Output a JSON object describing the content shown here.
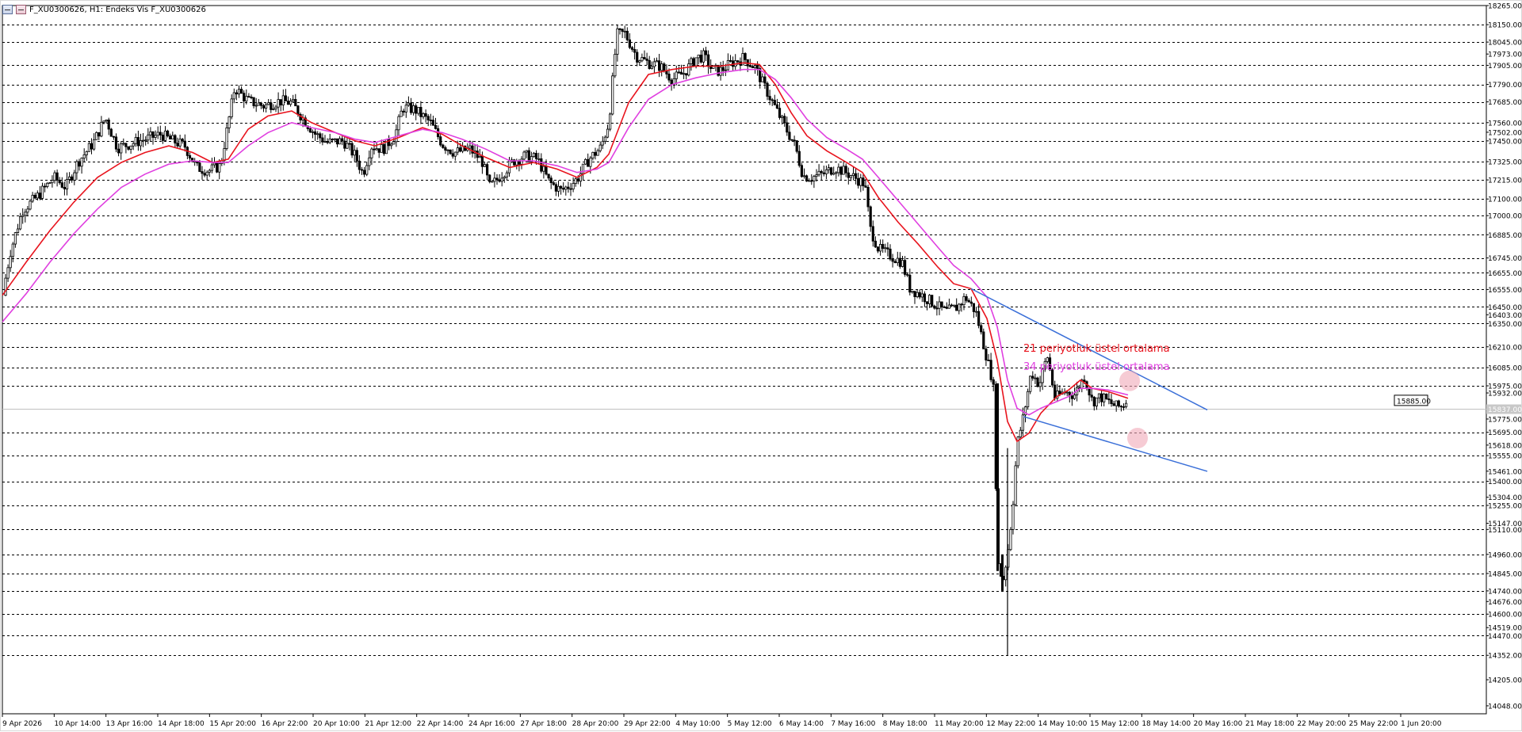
{
  "header": {
    "title": "F_XU0300626, H1:  Endeks Vis F_XU0300626"
  },
  "colors": {
    "ema21": "#e8141e",
    "ema34": "#e040e0",
    "trendlines": "#3a6fd8",
    "grid": "#000000",
    "candles": "#000000",
    "highlight": "#f0a8b8"
  },
  "annotations": {
    "ema21_label": "21 periyotluk üstel ortalama",
    "ema34_label": "34 periyotluk üstel ortalama"
  },
  "chart_data": {
    "type": "candlestick",
    "title": "F_XU0300626, H1:  Endeks Vis F_XU0300626",
    "ylim": [
      14000,
      18265
    ],
    "y_axis_labels": [
      "18265.00",
      "18150.00",
      "18045.00",
      "17973.00",
      "17905.00",
      "17790.00",
      "17685.00",
      "17560.00",
      "17502.00",
      "17450.00",
      "17325.00",
      "17215.00",
      "17100.00",
      "17000.00",
      "16885.00",
      "16745.00",
      "16655.00",
      "16555.00",
      "16450.00",
      "16403.00",
      "16350.00",
      "16210.00",
      "16085.00",
      "15975.00",
      "15932.00",
      "15775.00",
      "15695.00",
      "15618.00",
      "15555.00",
      "15461.00",
      "15400.00",
      "15304.00",
      "15255.00",
      "15147.00",
      "15110.00",
      "14960.00",
      "14845.00",
      "14740.00",
      "14676.00",
      "14600.00",
      "14519.00",
      "14470.00",
      "14352.00",
      "14205.00",
      "14048.00"
    ],
    "dashed_levels": [
      18150,
      18045,
      17905,
      17790,
      17685,
      17560,
      17450,
      17325,
      17215,
      17100,
      17000,
      16885,
      16745,
      16655,
      16555,
      16450,
      16350,
      16210,
      16085,
      15975,
      15695,
      15555,
      15400,
      15255,
      15110,
      14960,
      14845,
      14740,
      14600,
      14470,
      14352
    ],
    "current_price": "15885.00",
    "bid_level_label": "15837.00",
    "bid_level": 15837,
    "x_tick_labels": [
      "9 Apr 2026",
      "10 Apr 14:00",
      "13 Apr 16:00",
      "14 Apr 18:00",
      "15 Apr 20:00",
      "16 Apr 22:00",
      "20 Apr 10:00",
      "21 Apr 12:00",
      "22 Apr 14:00",
      "24 Apr 16:00",
      "27 Apr 18:00",
      "28 Apr 20:00",
      "29 Apr 22:00",
      "4 May 10:00",
      "5 May 12:00",
      "6 May 14:00",
      "7 May 16:00",
      "8 May 18:00",
      "11 May 20:00",
      "12 May 22:00",
      "14 May 10:00",
      "15 May 12:00",
      "18 May 14:00",
      "20 May 16:00",
      "21 May 18:00",
      "22 May 20:00",
      "25 May 22:00",
      "1 Jun 20:00"
    ],
    "price_path": [
      [
        0,
        16520
      ],
      [
        10,
        16780
      ],
      [
        25,
        17030
      ],
      [
        45,
        17120
      ],
      [
        65,
        17230
      ],
      [
        80,
        17170
      ],
      [
        95,
        17320
      ],
      [
        115,
        17440
      ],
      [
        130,
        17590
      ],
      [
        145,
        17410
      ],
      [
        160,
        17430
      ],
      [
        180,
        17460
      ],
      [
        200,
        17490
      ],
      [
        215,
        17450
      ],
      [
        230,
        17420
      ],
      [
        245,
        17290
      ],
      [
        260,
        17270
      ],
      [
        275,
        17300
      ],
      [
        285,
        17560
      ],
      [
        293,
        17770
      ],
      [
        310,
        17690
      ],
      [
        330,
        17660
      ],
      [
        350,
        17690
      ],
      [
        365,
        17680
      ],
      [
        380,
        17580
      ],
      [
        395,
        17490
      ],
      [
        410,
        17440
      ],
      [
        430,
        17450
      ],
      [
        445,
        17360
      ],
      [
        455,
        17250
      ],
      [
        465,
        17420
      ],
      [
        480,
        17400
      ],
      [
        495,
        17480
      ],
      [
        505,
        17650
      ],
      [
        520,
        17640
      ],
      [
        540,
        17560
      ],
      [
        555,
        17430
      ],
      [
        570,
        17380
      ],
      [
        590,
        17400
      ],
      [
        605,
        17330
      ],
      [
        615,
        17170
      ],
      [
        630,
        17250
      ],
      [
        645,
        17330
      ],
      [
        660,
        17360
      ],
      [
        675,
        17340
      ],
      [
        690,
        17200
      ],
      [
        705,
        17150
      ],
      [
        715,
        17180
      ],
      [
        725,
        17220
      ],
      [
        740,
        17340
      ],
      [
        755,
        17410
      ],
      [
        765,
        17560
      ],
      [
        775,
        18090
      ],
      [
        785,
        18100
      ],
      [
        800,
        17960
      ],
      [
        815,
        17920
      ],
      [
        830,
        17900
      ],
      [
        845,
        17820
      ],
      [
        860,
        17860
      ],
      [
        875,
        17950
      ],
      [
        885,
        17960
      ],
      [
        895,
        17880
      ],
      [
        905,
        17870
      ],
      [
        920,
        17920
      ],
      [
        935,
        17950
      ],
      [
        950,
        17890
      ],
      [
        960,
        17790
      ],
      [
        975,
        17650
      ],
      [
        990,
        17510
      ],
      [
        1000,
        17420
      ],
      [
        1010,
        17240
      ],
      [
        1020,
        17230
      ],
      [
        1035,
        17250
      ],
      [
        1050,
        17290
      ],
      [
        1060,
        17270
      ],
      [
        1075,
        17230
      ],
      [
        1088,
        17190
      ],
      [
        1095,
        16920
      ],
      [
        1105,
        16800
      ],
      [
        1120,
        16760
      ],
      [
        1135,
        16720
      ],
      [
        1145,
        16560
      ],
      [
        1160,
        16520
      ],
      [
        1175,
        16470
      ],
      [
        1190,
        16420
      ],
      [
        1205,
        16450
      ],
      [
        1215,
        16510
      ],
      [
        1228,
        16420
      ],
      [
        1240,
        16180
      ],
      [
        1250,
        15990
      ],
      [
        1256,
        14900
      ],
      [
        1262,
        14800
      ],
      [
        1268,
        14960
      ],
      [
        1274,
        15220
      ],
      [
        1280,
        15620
      ],
      [
        1288,
        15790
      ],
      [
        1298,
        16060
      ],
      [
        1308,
        15980
      ],
      [
        1318,
        16160
      ],
      [
        1328,
        15900
      ],
      [
        1340,
        15940
      ],
      [
        1352,
        15920
      ],
      [
        1365,
        16030
      ],
      [
        1375,
        15880
      ],
      [
        1385,
        15910
      ],
      [
        1395,
        15880
      ],
      [
        1405,
        15850
      ],
      [
        1412,
        15850
      ],
      [
        1418,
        15885
      ]
    ],
    "series": [
      {
        "name": "21 periyotluk üstel ortalama",
        "points": [
          [
            0,
            16520
          ],
          [
            30,
            16720
          ],
          [
            60,
            16910
          ],
          [
            90,
            17080
          ],
          [
            120,
            17230
          ],
          [
            150,
            17320
          ],
          [
            180,
            17380
          ],
          [
            210,
            17420
          ],
          [
            240,
            17380
          ],
          [
            265,
            17320
          ],
          [
            285,
            17340
          ],
          [
            310,
            17520
          ],
          [
            335,
            17600
          ],
          [
            365,
            17630
          ],
          [
            390,
            17560
          ],
          [
            420,
            17500
          ],
          [
            445,
            17450
          ],
          [
            470,
            17420
          ],
          [
            500,
            17470
          ],
          [
            530,
            17530
          ],
          [
            555,
            17490
          ],
          [
            580,
            17420
          ],
          [
            610,
            17350
          ],
          [
            640,
            17290
          ],
          [
            670,
            17320
          ],
          [
            700,
            17280
          ],
          [
            725,
            17230
          ],
          [
            750,
            17290
          ],
          [
            765,
            17370
          ],
          [
            790,
            17680
          ],
          [
            815,
            17850
          ],
          [
            845,
            17880
          ],
          [
            875,
            17900
          ],
          [
            905,
            17900
          ],
          [
            935,
            17920
          ],
          [
            955,
            17910
          ],
          [
            975,
            17790
          ],
          [
            995,
            17620
          ],
          [
            1015,
            17480
          ],
          [
            1040,
            17390
          ],
          [
            1065,
            17320
          ],
          [
            1085,
            17260
          ],
          [
            1105,
            17110
          ],
          [
            1130,
            16960
          ],
          [
            1155,
            16830
          ],
          [
            1180,
            16690
          ],
          [
            1200,
            16590
          ],
          [
            1222,
            16560
          ],
          [
            1242,
            16380
          ],
          [
            1255,
            16130
          ],
          [
            1268,
            15760
          ],
          [
            1280,
            15640
          ],
          [
            1295,
            15690
          ],
          [
            1310,
            15810
          ],
          [
            1330,
            15910
          ],
          [
            1345,
            15950
          ],
          [
            1360,
            16010
          ],
          [
            1375,
            15960
          ],
          [
            1395,
            15940
          ],
          [
            1420,
            15900
          ]
        ]
      },
      {
        "name": "34 periyotluk üstel ortalama",
        "points": [
          [
            0,
            16360
          ],
          [
            30,
            16530
          ],
          [
            60,
            16720
          ],
          [
            90,
            16890
          ],
          [
            120,
            17040
          ],
          [
            150,
            17170
          ],
          [
            180,
            17250
          ],
          [
            210,
            17310
          ],
          [
            240,
            17330
          ],
          [
            265,
            17320
          ],
          [
            285,
            17320
          ],
          [
            310,
            17420
          ],
          [
            335,
            17500
          ],
          [
            365,
            17560
          ],
          [
            390,
            17530
          ],
          [
            420,
            17500
          ],
          [
            445,
            17460
          ],
          [
            470,
            17440
          ],
          [
            500,
            17480
          ],
          [
            530,
            17520
          ],
          [
            555,
            17500
          ],
          [
            580,
            17460
          ],
          [
            610,
            17400
          ],
          [
            640,
            17330
          ],
          [
            670,
            17330
          ],
          [
            700,
            17300
          ],
          [
            725,
            17260
          ],
          [
            750,
            17280
          ],
          [
            765,
            17320
          ],
          [
            790,
            17530
          ],
          [
            815,
            17700
          ],
          [
            845,
            17790
          ],
          [
            875,
            17830
          ],
          [
            905,
            17860
          ],
          [
            935,
            17880
          ],
          [
            955,
            17880
          ],
          [
            975,
            17820
          ],
          [
            995,
            17710
          ],
          [
            1015,
            17580
          ],
          [
            1040,
            17470
          ],
          [
            1065,
            17400
          ],
          [
            1085,
            17340
          ],
          [
            1105,
            17230
          ],
          [
            1130,
            17090
          ],
          [
            1155,
            16950
          ],
          [
            1180,
            16810
          ],
          [
            1200,
            16700
          ],
          [
            1222,
            16620
          ],
          [
            1242,
            16510
          ],
          [
            1255,
            16330
          ],
          [
            1268,
            16010
          ],
          [
            1280,
            15840
          ],
          [
            1295,
            15800
          ],
          [
            1310,
            15840
          ],
          [
            1330,
            15880
          ],
          [
            1345,
            15910
          ],
          [
            1360,
            15960
          ],
          [
            1375,
            15960
          ],
          [
            1395,
            15950
          ],
          [
            1420,
            15920
          ]
        ]
      }
    ],
    "trendlines": [
      {
        "from": [
          1222,
          16560
        ],
        "to": [
          1520,
          15830
        ]
      },
      {
        "from": [
          1288,
          15790
        ],
        "to": [
          1520,
          15460
        ]
      }
    ],
    "highlight_markers": [
      {
        "x": 1422,
        "y": 16005
      },
      {
        "x": 1432,
        "y": 15660
      }
    ]
  }
}
